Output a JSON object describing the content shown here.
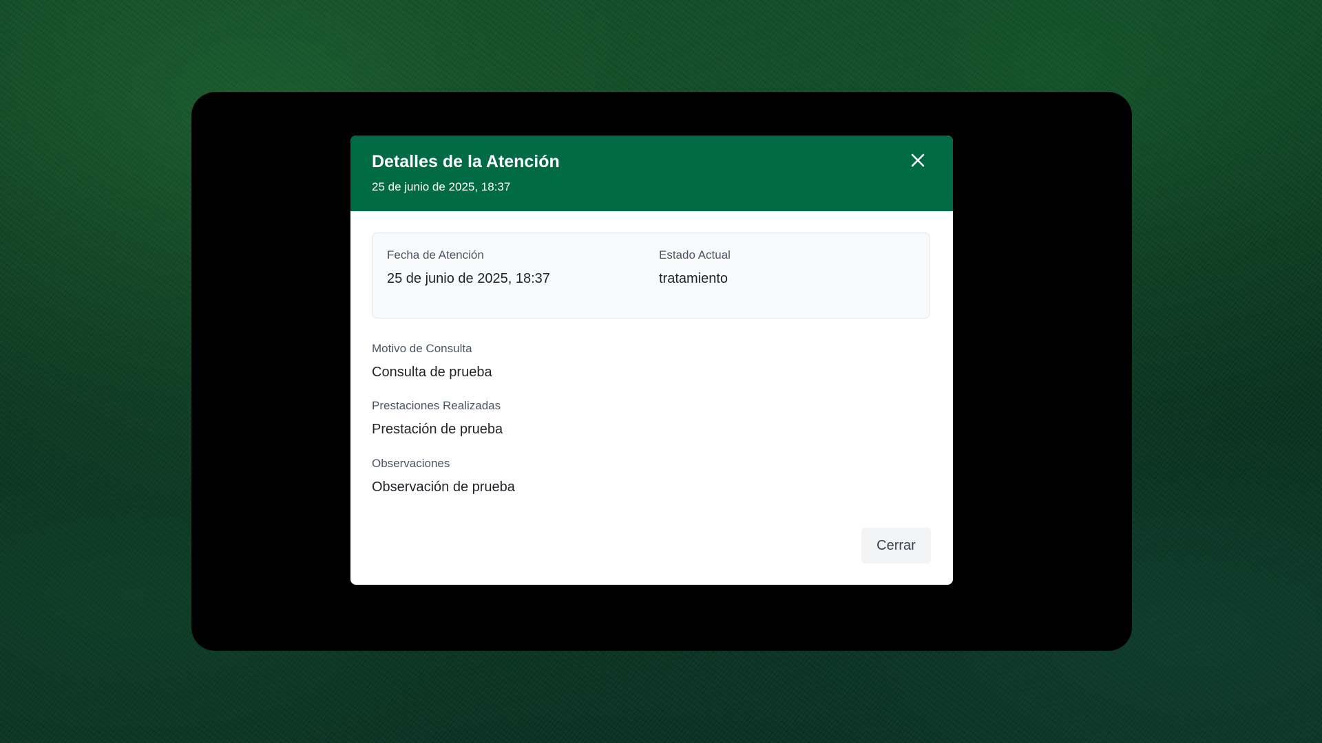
{
  "modal": {
    "title": "Detalles de la Atención",
    "subtitle": "25 de junio de 2025, 18:37",
    "close_icon": "close-icon",
    "header_color": "#006b45"
  },
  "summary": {
    "date_label": "Fecha de Atención",
    "date_value": "25 de junio de 2025, 18:37",
    "status_label": "Estado Actual",
    "status_value": "tratamiento"
  },
  "fields": [
    {
      "label": "Motivo de Consulta",
      "value": "Consulta de prueba"
    },
    {
      "label": "Prestaciones Realizadas",
      "value": "Prestación de prueba"
    },
    {
      "label": "Observaciones",
      "value": "Observación de prueba"
    }
  ],
  "footer": {
    "close_button_label": "Cerrar"
  }
}
